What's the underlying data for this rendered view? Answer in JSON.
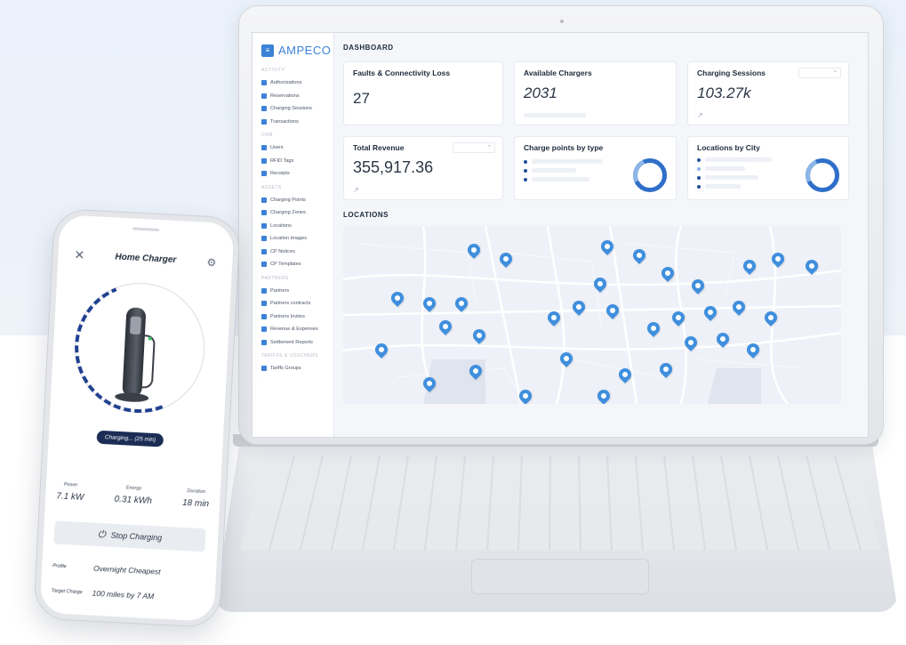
{
  "app": {
    "brand": "AMPECO",
    "brand_mark": "≡"
  },
  "sidebar": {
    "sections": [
      {
        "label": "ACTIVITY",
        "items": [
          "Authorizations",
          "Reservations",
          "Charging Sessions",
          "Transactions"
        ]
      },
      {
        "label": "CRM",
        "items": [
          "Users",
          "RFID Tags",
          "Receipts"
        ]
      },
      {
        "label": "ASSETS",
        "items": [
          "Charging Points",
          "Charging Zones",
          "Locations",
          "Location Images",
          "CP Notices",
          "CP Templates"
        ]
      },
      {
        "label": "PARTNERS",
        "items": [
          "Partners",
          "Partners contracts",
          "Partners Invites",
          "Revenue & Expenses",
          "Settlement Reports"
        ]
      },
      {
        "label": "TARIFFS & VOUCHERS",
        "items": [
          "Tariffs Groups"
        ]
      }
    ]
  },
  "dashboard": {
    "title": "DASHBOARD",
    "cards": {
      "faults": {
        "title": "Faults & Connectivity Loss",
        "value": "27"
      },
      "available": {
        "title": "Available Chargers",
        "value": "2031"
      },
      "sessions": {
        "title": "Charging Sessions",
        "value": "103.27k"
      },
      "revenue": {
        "title": "Total Revenue",
        "value": "355,917.36"
      },
      "by_type": {
        "title": "Charge points by type"
      },
      "by_city": {
        "title": "Locations by City"
      }
    },
    "locations_title": "LOCATIONS",
    "pin_count": 34
  },
  "phone": {
    "title": "Home Charger",
    "status": "Charging... (25 min)",
    "stats": [
      {
        "label": "Power",
        "value": "7.1 kW"
      },
      {
        "label": "Energy",
        "value": "0.31 kWh"
      },
      {
        "label": "Duration",
        "value": "18 min"
      }
    ],
    "stop_label": "Stop Charging",
    "profile_label": "Profile",
    "profile_value": "Overnight Cheapest",
    "target_label": "Target Charge",
    "target_value": "100 miles by 7 AM"
  },
  "colors": {
    "accent": "#3c82d6",
    "pin": "#3f8fde",
    "pill": "#1b2d55",
    "donut": "#2f6fc9"
  }
}
